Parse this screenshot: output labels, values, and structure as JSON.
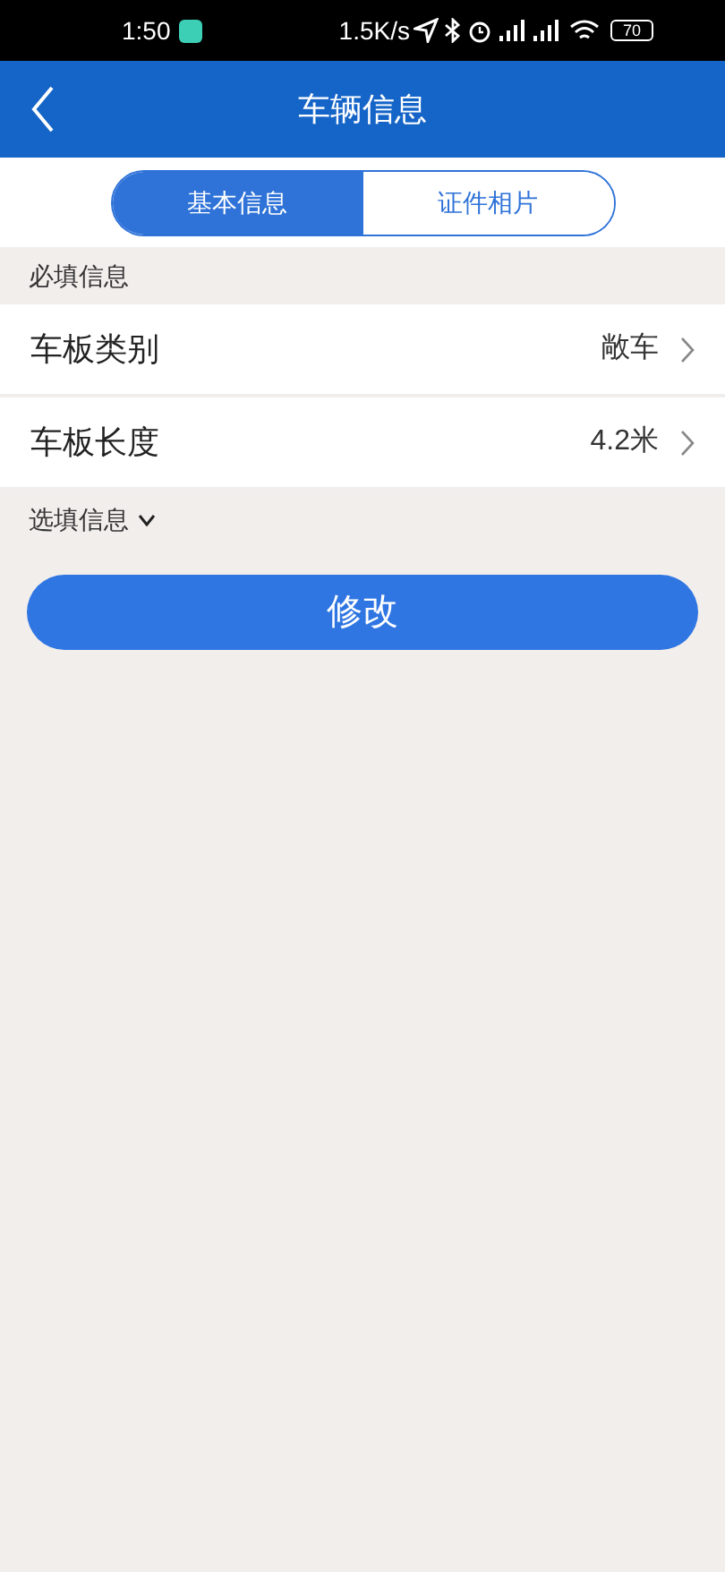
{
  "status_bar": {
    "time": "1:50",
    "speed": "1.5K/s",
    "battery": "70"
  },
  "header": {
    "title": "车辆信息"
  },
  "tabs": [
    {
      "label": "基本信息",
      "selected": true
    },
    {
      "label": "证件相片",
      "selected": false
    }
  ],
  "required_section": {
    "title": "必填信息",
    "rows": [
      {
        "label": "车板类别",
        "value": "敞车"
      },
      {
        "label": "车板长度",
        "value": "4.2米"
      }
    ]
  },
  "optional_section": {
    "title": "选填信息",
    "expanded": false
  },
  "submit_button": "修改"
}
